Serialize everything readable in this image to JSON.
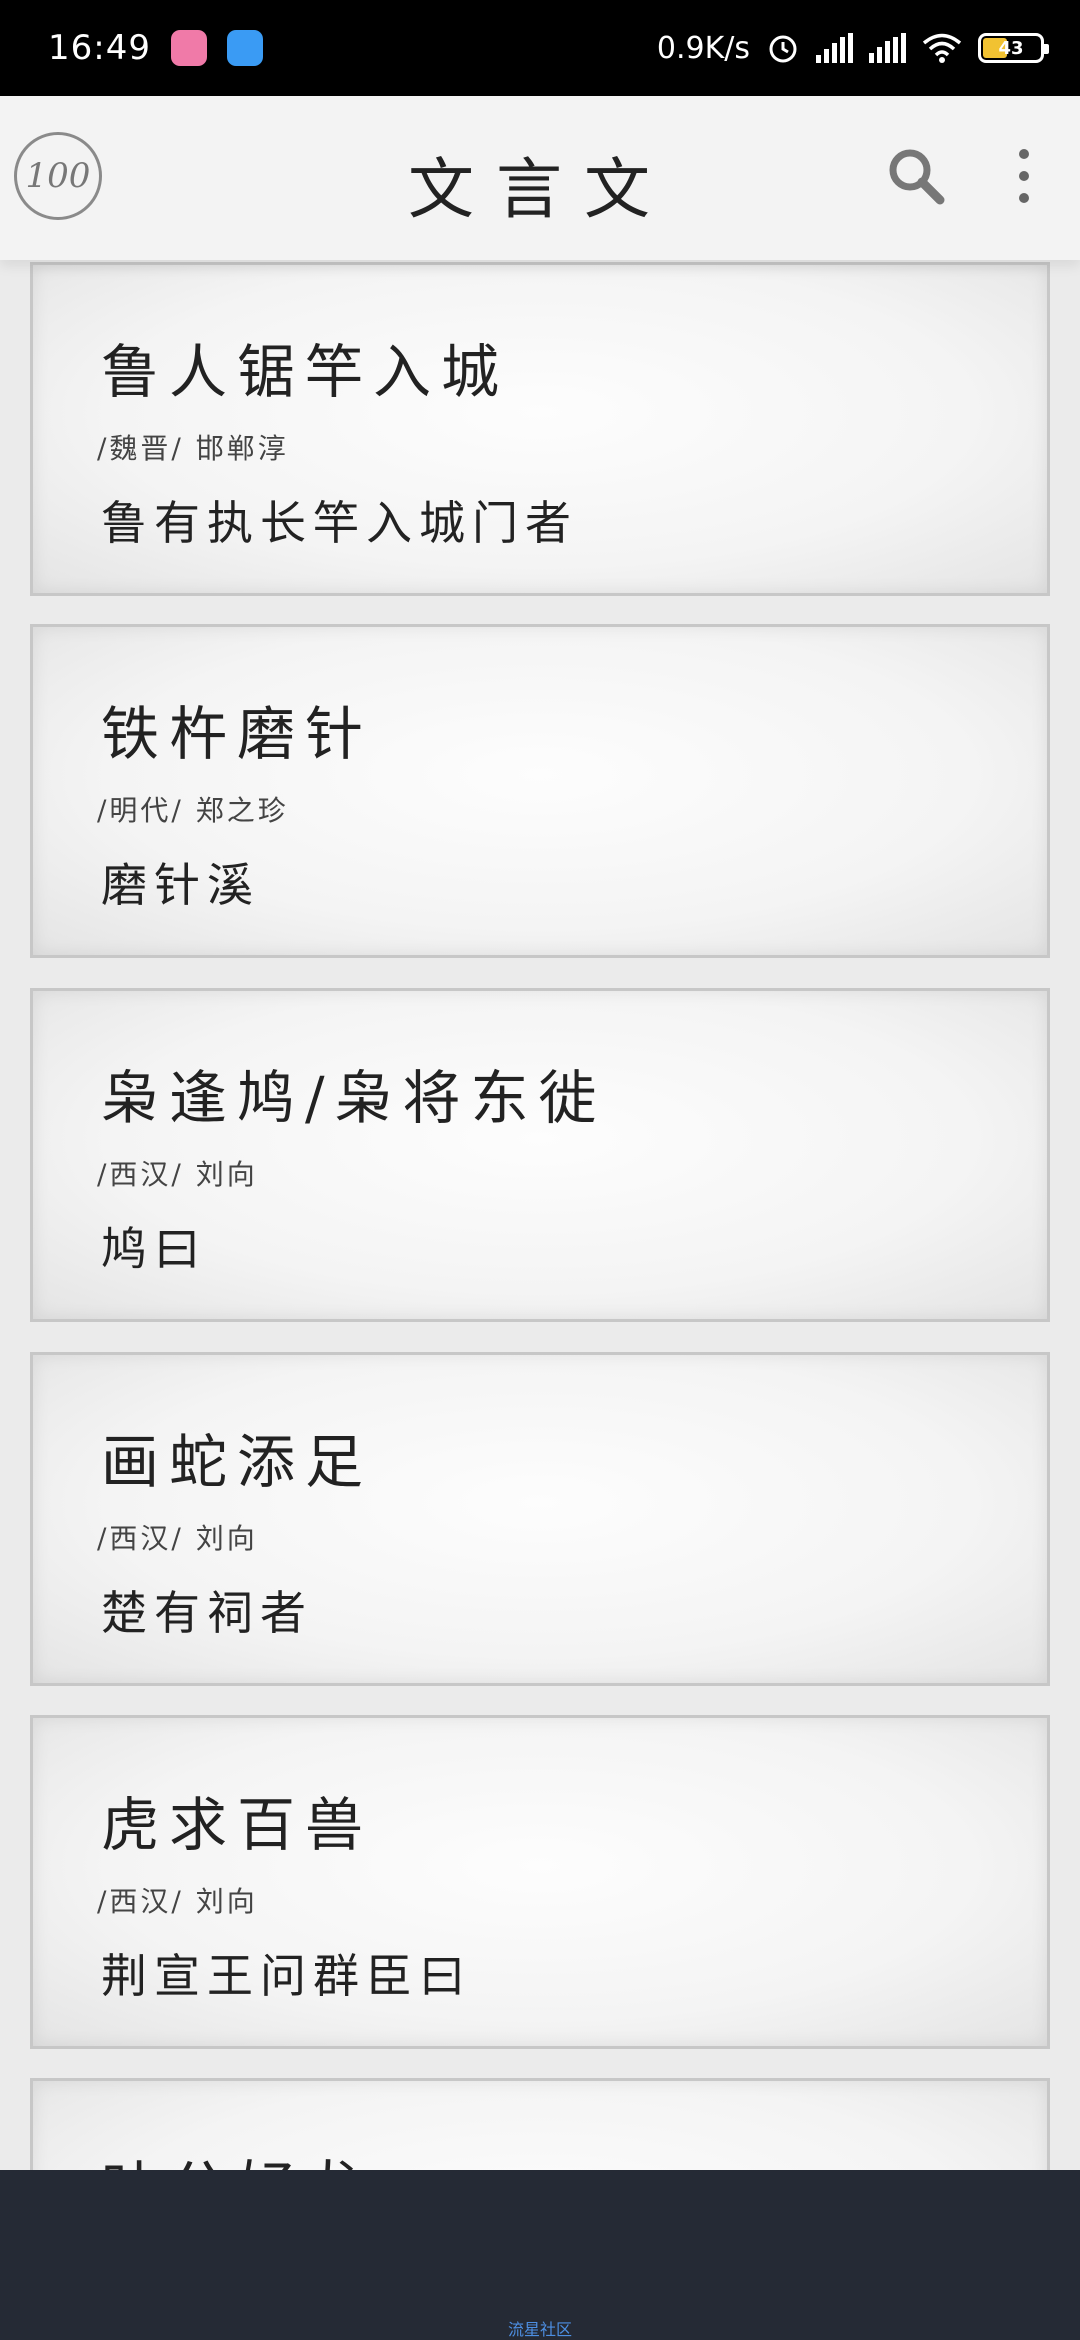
{
  "status_bar": {
    "time": "16:49",
    "network_speed": "0.9K/s",
    "battery": "43",
    "battery_level": 0.43,
    "icons": [
      "pink-app-icon",
      "blue-app-icon",
      "alarm-icon",
      "signal-icon",
      "hd-signal-icon",
      "wifi-icon",
      "battery-icon"
    ]
  },
  "app_bar": {
    "logo_text": "100",
    "title": "文言文",
    "icons": [
      "search-icon",
      "more-vert-icon"
    ]
  },
  "works": [
    {
      "title": "鲁人锯竿入城",
      "meta": "/魏晋/ 邯郸淳",
      "first_line": "鲁有执长竿入城门者"
    },
    {
      "title": "铁杵磨针",
      "meta": "/明代/ 郑之珍",
      "first_line": "磨针溪"
    },
    {
      "title": "枭逢鸠/枭将东徙",
      "meta": "/西汉/ 刘向",
      "first_line": "鸠曰"
    },
    {
      "title": "画蛇添足",
      "meta": "/西汉/ 刘向",
      "first_line": "楚有祠者"
    },
    {
      "title": "虎求百兽",
      "meta": "/西汉/ 刘向",
      "first_line": "荆宣王问群臣曰"
    },
    {
      "title": "叶公好龙",
      "meta": "",
      "first_line": ""
    }
  ],
  "watermark": "流星社区",
  "colors": {
    "status_bar_bg": "#000000",
    "app_bar_bg": "#f3f3f3",
    "page_bg": "#ebebeb",
    "bottom_bar_bg": "#252a35",
    "battery_fill": "#f1c232",
    "watermark": "#4d8fe3"
  }
}
